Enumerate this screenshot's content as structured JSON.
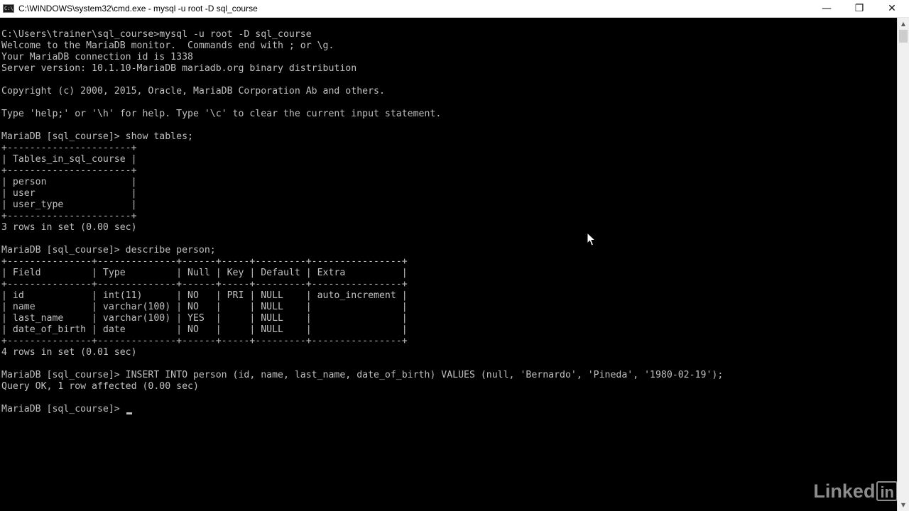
{
  "window": {
    "title": "C:\\WINDOWS\\system32\\cmd.exe - mysql  -u root -D sql_course",
    "icon": "cmd-icon",
    "icon_text": "C:\\",
    "controls": {
      "minimize": "—",
      "maximize": "❐",
      "close": "✕"
    }
  },
  "terminal": {
    "lines": [
      "C:\\Users\\trainer\\sql_course>mysql -u root -D sql_course",
      "Welcome to the MariaDB monitor.  Commands end with ; or \\g.",
      "Your MariaDB connection id is 1338",
      "Server version: 10.1.10-MariaDB mariadb.org binary distribution",
      "",
      "Copyright (c) 2000, 2015, Oracle, MariaDB Corporation Ab and others.",
      "",
      "Type 'help;' or '\\h' for help. Type '\\c' to clear the current input statement.",
      "",
      "MariaDB [sql_course]> show tables;",
      "+----------------------+",
      "| Tables_in_sql_course |",
      "+----------------------+",
      "| person               |",
      "| user                 |",
      "| user_type            |",
      "+----------------------+",
      "3 rows in set (0.00 sec)",
      "",
      "MariaDB [sql_course]> describe person;",
      "+---------------+--------------+------+-----+---------+----------------+",
      "| Field         | Type         | Null | Key | Default | Extra          |",
      "+---------------+--------------+------+-----+---------+----------------+",
      "| id            | int(11)      | NO   | PRI | NULL    | auto_increment |",
      "| name          | varchar(100) | NO   |     | NULL    |                |",
      "| last_name     | varchar(100) | YES  |     | NULL    |                |",
      "| date_of_birth | date         | NO   |     | NULL    |                |",
      "+---------------+--------------+------+-----+---------+----------------+",
      "4 rows in set (0.01 sec)",
      "",
      "MariaDB [sql_course]> INSERT INTO person (id, name, last_name, date_of_birth) VALUES (null, 'Bernardo', 'Pineda', '1980-02-19');",
      "Query OK, 1 row affected (0.00 sec)",
      "",
      "MariaDB [sql_course]> "
    ]
  },
  "watermark": {
    "text": "Linked",
    "box": "in"
  },
  "colors": {
    "terminal_bg": "#000000",
    "terminal_fg": "#c0c0c0",
    "titlebar_bg": "#ffffff"
  }
}
